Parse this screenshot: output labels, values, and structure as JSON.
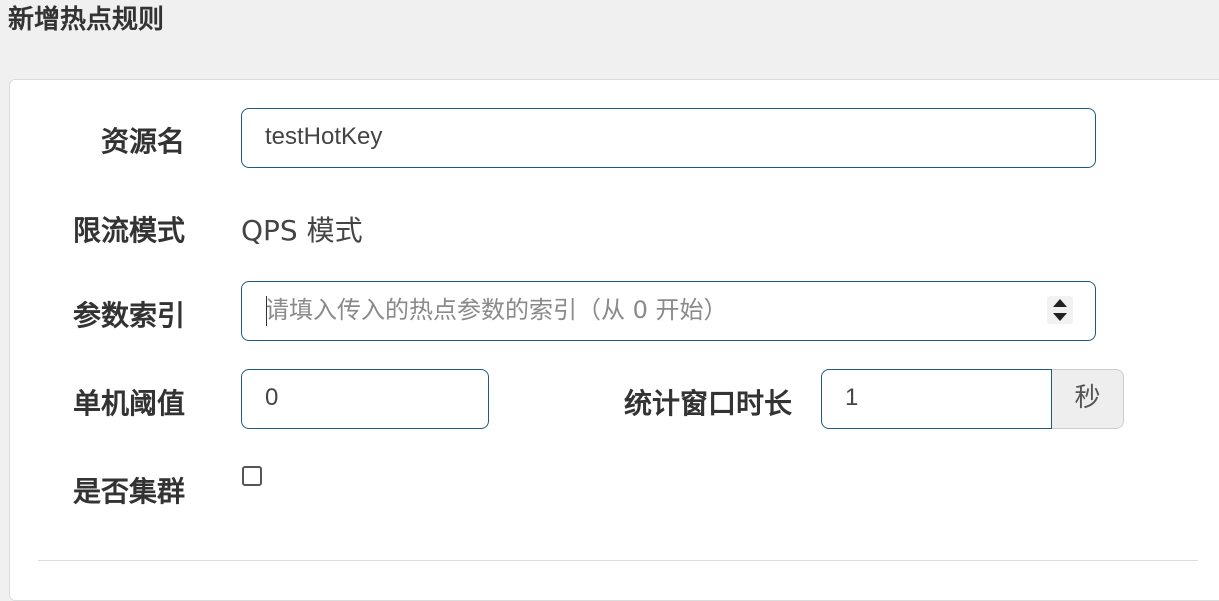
{
  "dialog": {
    "title": "新增热点规则"
  },
  "form": {
    "resource": {
      "label": "资源名",
      "value": "testHotKey"
    },
    "mode": {
      "label": "限流模式",
      "value": "QPS 模式"
    },
    "param_index": {
      "label": "参数索引",
      "placeholder": "请填入传入的热点参数的索引（从 0 开始）"
    },
    "threshold": {
      "label": "单机阈值",
      "value": "0"
    },
    "window": {
      "label": "统计窗口时长",
      "value": "1",
      "unit": "秒"
    },
    "cluster": {
      "label": "是否集群",
      "checked": false
    }
  },
  "icons": {
    "spinner": "spinner-arrows-icon"
  },
  "colors": {
    "input_border": "#1f5a86",
    "panel_bg": "#ffffff",
    "page_bg": "#f0f0f0"
  }
}
